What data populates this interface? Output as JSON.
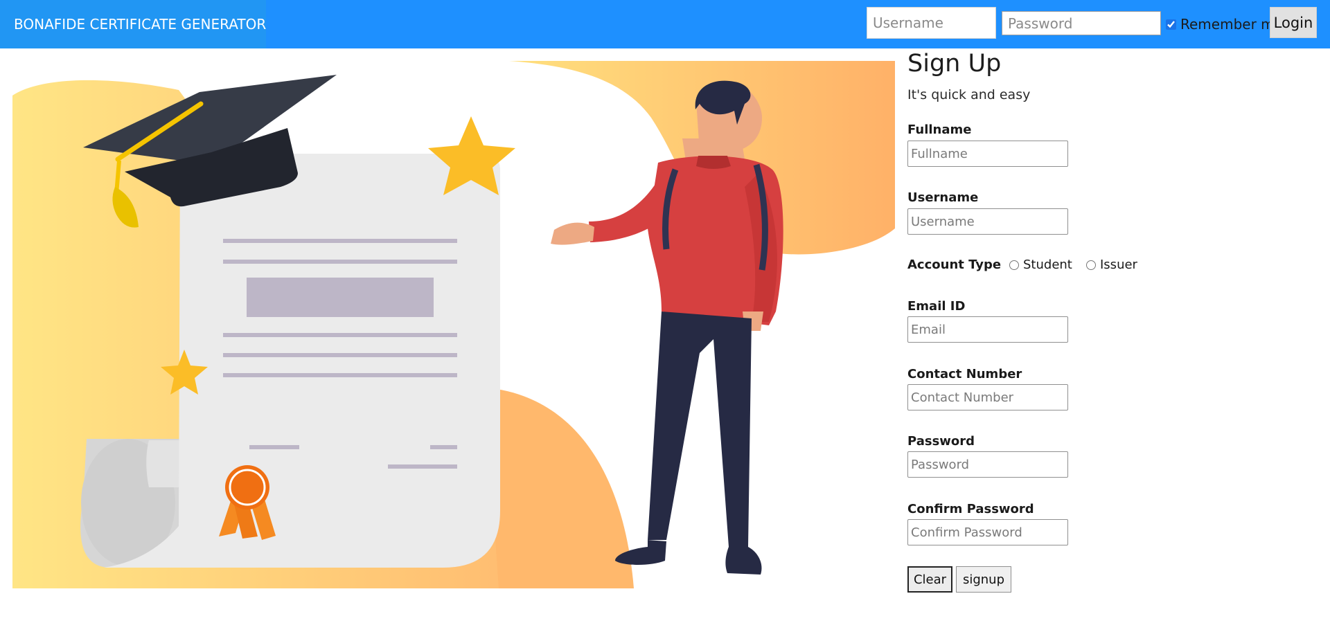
{
  "navbar": {
    "brand": "BONAFIDE CERTIFICATE GENERATOR",
    "username_placeholder": "Username",
    "password_placeholder": "Password",
    "remember_label": "Remember me",
    "remember_checked": true,
    "login_label": "Login"
  },
  "signup": {
    "title": "Sign Up",
    "subtitle": "It's quick and easy",
    "fullname_label": "Fullname",
    "fullname_placeholder": "Fullname",
    "username_label": "Username",
    "username_placeholder": "Username",
    "account_type_label": "Account Type",
    "account_type_options": [
      "Student",
      "Issuer"
    ],
    "email_label": "Email ID",
    "email_placeholder": "Email",
    "contact_label": "Contact Number",
    "contact_placeholder": "Contact Number",
    "password_label": "Password",
    "password_placeholder": "Password",
    "confirm_label": "Confirm Password",
    "confirm_placeholder": "Confirm Password",
    "clear_label": "Clear",
    "signup_label": "signup"
  },
  "colors": {
    "navbar": "#1e90ff",
    "brand_bg": "#2196f3",
    "gradient_start": "#ffe27a",
    "gradient_end": "#ffb36b",
    "paper": "#ebebeb",
    "cap": "#2e323d",
    "star": "#fbbd27",
    "shirt": "#d64040",
    "pants": "#262a44",
    "skin": "#eda983",
    "ribbon": "#f06f12"
  },
  "illustration": {
    "icons": [
      "graduation-cap-icon",
      "star-icon",
      "diploma-icon",
      "award-ribbon-icon",
      "student-figure-icon"
    ]
  }
}
